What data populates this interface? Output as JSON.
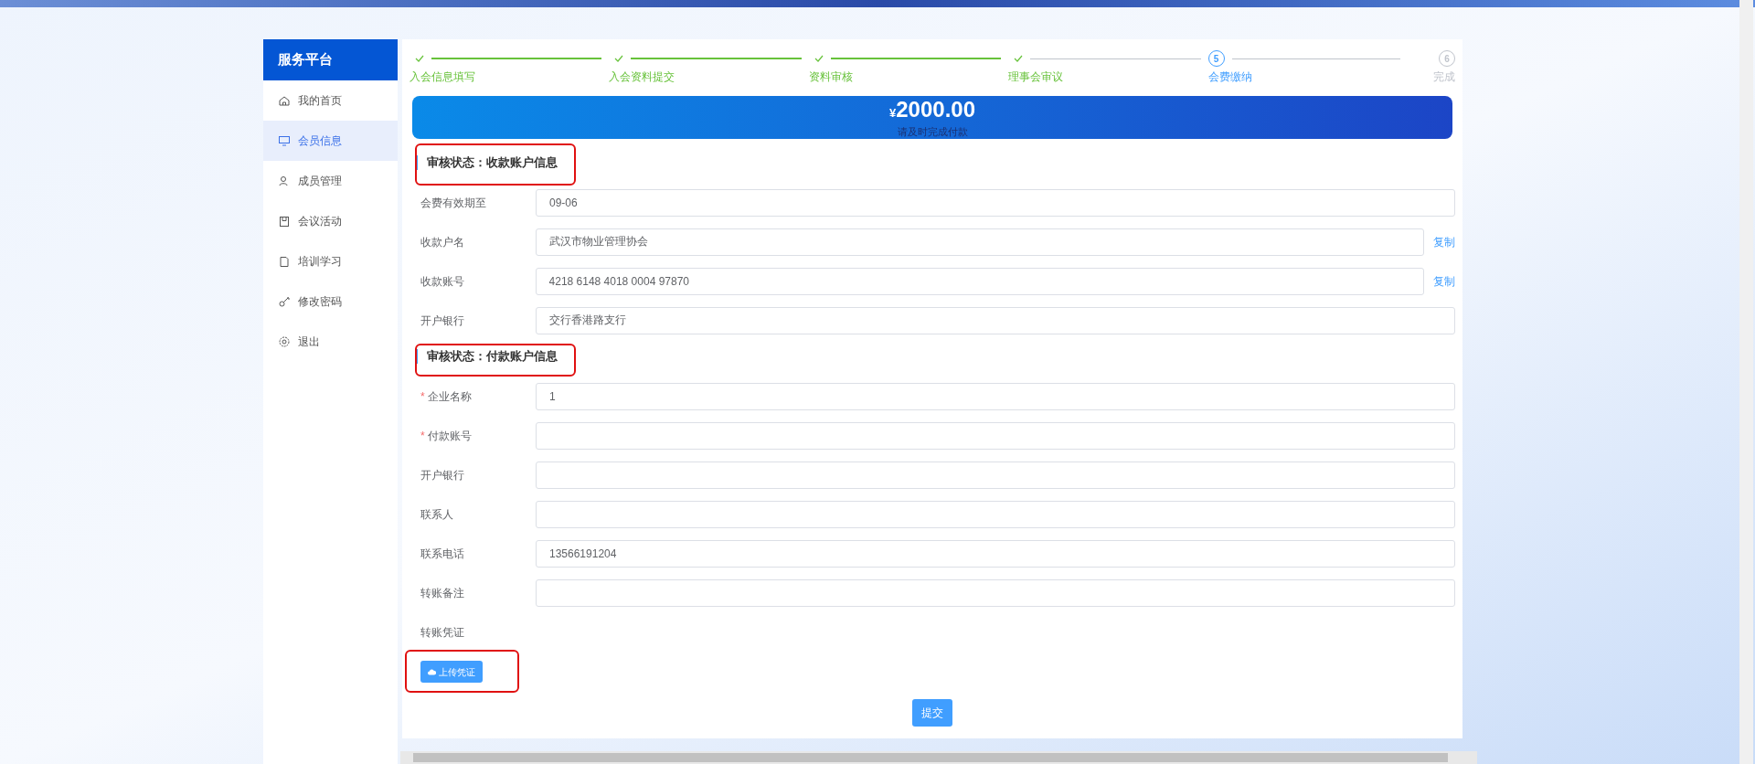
{
  "sidebar": {
    "title": "服务平台",
    "items": [
      {
        "label": "我的首页",
        "selected": false
      },
      {
        "label": "会员信息",
        "selected": true
      },
      {
        "label": "成员管理",
        "selected": false
      },
      {
        "label": "会议活动",
        "selected": false
      },
      {
        "label": "培训学习",
        "selected": false
      },
      {
        "label": "修改密码",
        "selected": false
      },
      {
        "label": "退出",
        "selected": false
      }
    ]
  },
  "steps": [
    {
      "label": "入会信息填写",
      "kind": "done"
    },
    {
      "label": "入会资料提交",
      "kind": "done"
    },
    {
      "label": "资料审核",
      "kind": "done"
    },
    {
      "label": "理事会审议",
      "kind": "done"
    },
    {
      "label": "会费缴纳",
      "kind": "active",
      "number": "5"
    },
    {
      "label": "完成",
      "kind": "pending",
      "number": "6"
    }
  ],
  "banner": {
    "amount": "2000.00",
    "currency": "¥",
    "note": "请及时完成付款"
  },
  "sections": [
    {
      "title": "审核状态：收款账户信息",
      "rows": [
        {
          "kind": "field",
          "label": "会费有效期至",
          "value": "09-06"
        },
        {
          "kind": "field",
          "label": "收款户名",
          "value": "武汉市物业管理协会",
          "link": "复制"
        },
        {
          "kind": "field",
          "label": "收款账号",
          "value": "4218 6148 4018 0004 97870",
          "link": "复制"
        },
        {
          "kind": "field",
          "label": "开户银行",
          "value": "交行香港路支行"
        }
      ]
    },
    {
      "title": "审核状态：付款账户信息",
      "rows": [
        {
          "kind": "field",
          "label": "企业名称",
          "value": "1",
          "required_mark": "*"
        },
        {
          "kind": "field",
          "label": "付款账号",
          "required_mark": "*"
        },
        {
          "kind": "field",
          "label": "开户银行"
        },
        {
          "kind": "field",
          "label": "联系人"
        },
        {
          "kind": "field",
          "label": "联系电话",
          "value": "13566191204"
        },
        {
          "kind": "field",
          "label": "转账备注"
        },
        {
          "kind": "label",
          "label": "转账凭证"
        },
        {
          "kind": "upload",
          "button": "上传凭证"
        }
      ]
    }
  ],
  "submit": "提交"
}
